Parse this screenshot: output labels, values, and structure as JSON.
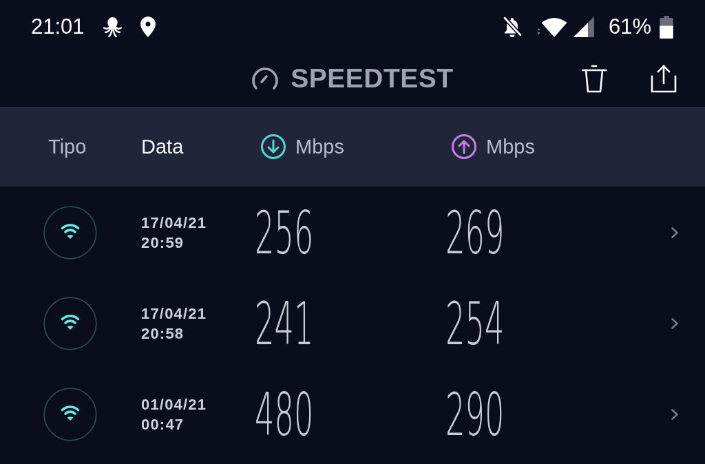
{
  "status_bar": {
    "time": "21:01",
    "battery": "61%"
  },
  "app_bar": {
    "title": "SPEEDTEST"
  },
  "table": {
    "columns": [
      {
        "label": "Tipo",
        "kind": "type",
        "selected": false
      },
      {
        "label": "Data",
        "kind": "date",
        "selected": true
      },
      {
        "label": "Mbps",
        "kind": "download",
        "selected": false
      },
      {
        "label": "Mbps",
        "kind": "upload",
        "selected": false
      }
    ],
    "rows": [
      {
        "kind": "wifi",
        "date": "17/04/21",
        "time": "20:59",
        "download": "256",
        "upload": "269"
      },
      {
        "kind": "wifi",
        "date": "17/04/21",
        "time": "20:58",
        "download": "241",
        "upload": "254"
      },
      {
        "kind": "wifi",
        "date": "01/04/21",
        "time": "00:47",
        "download": "480",
        "upload": "290"
      }
    ]
  }
}
